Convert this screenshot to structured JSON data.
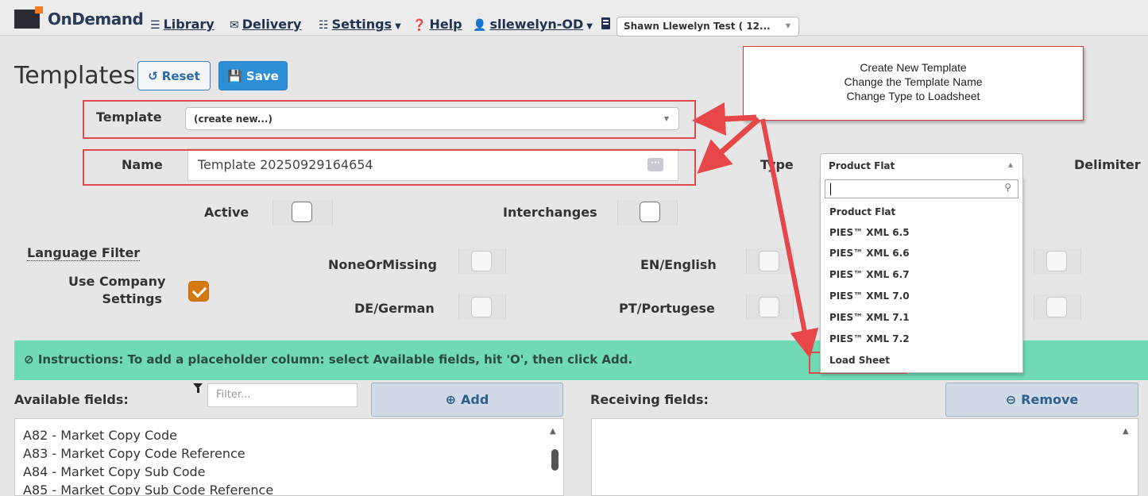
{
  "nav": {
    "brand": "OnDemand",
    "library": "Library",
    "delivery": "Delivery",
    "settings": "Settings",
    "help": "Help",
    "user": "sllewelyn-OD",
    "company": "Shawn Llewelyn Test ( 12..."
  },
  "page": {
    "title": "Templates",
    "reset_label": "Reset",
    "save_label": "Save"
  },
  "form": {
    "template_label": "Template",
    "template_value": "(create new...)",
    "name_label": "Name",
    "name_value": "Template 20250929164654",
    "type_label": "Type",
    "type_value": "Product Flat",
    "delimiter_label": "Delimiter",
    "active_label": "Active",
    "interchanges_label": "Interchanges"
  },
  "language": {
    "filter_label": "Language Filter",
    "use_company_label_1": "Use Company",
    "use_company_label_2": "Settings",
    "none_label": "NoneOrMissing",
    "en_label": "EN/English",
    "de_label": "DE/German",
    "pt_label": "PT/Portugese"
  },
  "type_dropdown": {
    "options": [
      "Product Flat",
      "PIES™ XML 6.5",
      "PIES™ XML 6.6",
      "PIES™ XML 6.7",
      "PIES™ XML 7.0",
      "PIES™ XML 7.1",
      "PIES™ XML 7.2",
      "Load Sheet"
    ]
  },
  "callout": {
    "line1": "Create New Template",
    "line2": "Change the Template Name",
    "line3": "Change Type to Loadsheet"
  },
  "instructions": "Instructions: To add a placeholder column: select Available fields, hit 'O', then click Add.",
  "fields": {
    "available_label": "Available fields:",
    "filter_placeholder": "Filter...",
    "add_label": "Add",
    "receiving_label": "Receiving fields:",
    "remove_label": "Remove",
    "available_items": [
      "A82 - Market Copy Code",
      "A83 - Market Copy Code Reference",
      "A84 - Market Copy Sub Code",
      "A85 - Market Copy Sub Code Reference"
    ]
  },
  "colors": {
    "accent": "#2c8fd6",
    "annotation_red": "#e04a4a",
    "instructions_bg": "#6fdab3",
    "checkbox_checked": "#d47a12"
  }
}
